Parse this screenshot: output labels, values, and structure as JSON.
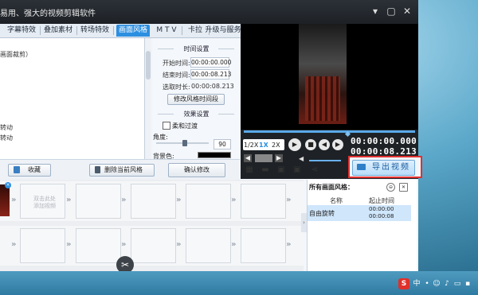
{
  "window": {
    "title": "易用、强大的视频剪辑软件",
    "controls": [
      "▾",
      "▢",
      "✕"
    ]
  },
  "tabs": [
    {
      "label": "字幕特效",
      "active": false
    },
    {
      "label": "叠加素材",
      "active": false
    },
    {
      "label": "转场特效",
      "active": false
    },
    {
      "label": "画面风格",
      "active": true
    },
    {
      "label": "M T V",
      "active": false
    },
    {
      "label": "卡拉OK",
      "active": false
    },
    {
      "label": "升级与服务",
      "active": false
    }
  ],
  "style_list": {
    "rows": [
      "画面裁剪）",
      "",
      "",
      "",
      "",
      "",
      "",
      "",
      "转动",
      "转动"
    ]
  },
  "time_settings": {
    "section_title": "时间设置",
    "start_label": "开始时间:",
    "start_value": "00:00:00.000",
    "end_label": "结束时间:",
    "end_value": "00:00:08.213",
    "duration_label": "选取时长:",
    "duration_value": "00:00:08.213",
    "modify_button": "修改风格时间段"
  },
  "effect_settings": {
    "section_title": "效果设置",
    "fade_label": "柔和过渡",
    "fade_checked": false,
    "angle_label": "角度:",
    "angle_value": "90",
    "angle_level": 0.55,
    "bg_label": "背景色:",
    "bg_color": "#000000"
  },
  "ops": {
    "favorite_button": "收藏",
    "delete_button": "删除当前风格",
    "confirm_button": "确认修改"
  },
  "player": {
    "progress": 1.0,
    "speeds": [
      "1/2X",
      "1X",
      "2X"
    ],
    "active_speed": "1X",
    "current_time": "00:00:00.000",
    "total_time": "00:00:08.213",
    "export_label": "导出视频"
  },
  "timeline": {
    "placeholder": "双击此处\n添加视频",
    "row1_slots": 6,
    "row2_slots": 6
  },
  "styles_panel": {
    "title": "所有画面风格：",
    "col_name": "名称",
    "col_time": "起止时间",
    "rows": [
      {
        "name": "自由旋转",
        "start": "00:00:00",
        "end": "00:00:08"
      }
    ]
  },
  "colors": {
    "accent": "#2c8fe0",
    "export_highlight": "#e03030"
  }
}
